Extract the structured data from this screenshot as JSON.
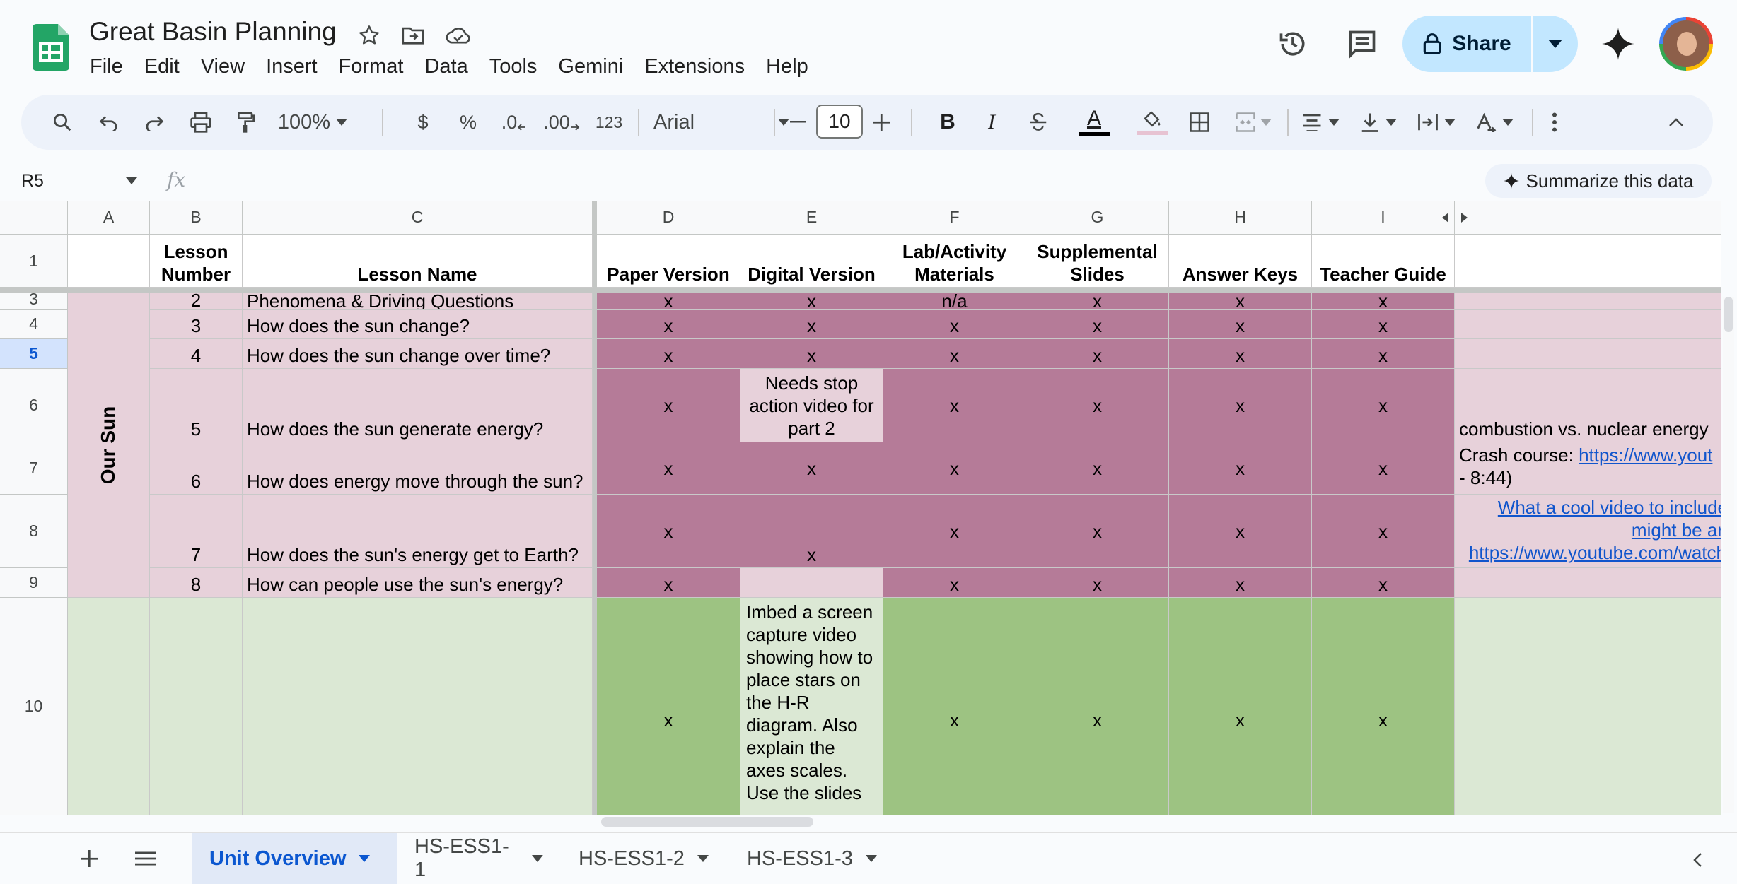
{
  "doc": {
    "title": "Great Basin Planning"
  },
  "menu": [
    "File",
    "Edit",
    "View",
    "Insert",
    "Format",
    "Data",
    "Tools",
    "Gemini",
    "Extensions",
    "Help"
  ],
  "share": {
    "label": "Share"
  },
  "toolbar": {
    "zoom": "100%",
    "currency": "$",
    "percent": "%",
    "dec_decrease": ".0",
    "dec_increase": ".00",
    "number_format": "123",
    "font": "Arial",
    "font_size": "10",
    "bold": "B",
    "italic": "I",
    "text_color_letter": "A"
  },
  "formula_bar": {
    "cell_ref": "R5",
    "fx": "fx",
    "summarize": "Summarize this data"
  },
  "columns": [
    "A",
    "B",
    "C",
    "D",
    "E",
    "F",
    "G",
    "H",
    "I"
  ],
  "header_row": {
    "row": "1",
    "b": "Lesson Number",
    "c": "Lesson Name",
    "d": "Paper Version",
    "e": "Digital Version",
    "f": "Lab/Activity Materials",
    "g": "Supplemental Slides",
    "h": "Answer Keys",
    "i": "Teacher Guide"
  },
  "group_label": "Our Sun",
  "rows": [
    {
      "row": "3",
      "b": "2",
      "c": "Phenomena & Driving Questions",
      "d": "x",
      "e": "x",
      "f": "n/a",
      "g": "x",
      "h": "x",
      "i": "x",
      "j": ""
    },
    {
      "row": "4",
      "b": "3",
      "c": "How does the sun change?",
      "d": "x",
      "e": "x",
      "f": "x",
      "g": "x",
      "h": "x",
      "i": "x",
      "j": ""
    },
    {
      "row": "5",
      "b": "4",
      "c": "How does the sun change over time?",
      "d": "x",
      "e": "x",
      "f": "x",
      "g": "x",
      "h": "x",
      "i": "x",
      "j": ""
    },
    {
      "row": "6",
      "b": "5",
      "c": "How does the sun generate energy?",
      "d": "x",
      "e": "Needs stop action video for part 2",
      "f": "x",
      "g": "x",
      "h": "x",
      "i": "x",
      "j": "combustion vs. nuclear energy"
    },
    {
      "row": "7",
      "b": "6",
      "c": "How does energy move through the sun?",
      "d": "x",
      "e": "x",
      "f": "x",
      "g": "x",
      "h": "x",
      "i": "x",
      "j_prefix": "Crash course: ",
      "j_link": "https://www.yout",
      "j_suffix": "- 8:44)"
    },
    {
      "row": "8",
      "b": "7",
      "c": "How does the sun's energy get to Earth?",
      "d": "x",
      "e": "x",
      "f": "x",
      "g": "x",
      "h": "x",
      "i": "x",
      "j_link1": "What a cool video to include",
      "j_link2": "might be ar",
      "j_link3": "https://www.youtube.com/watch"
    },
    {
      "row": "9",
      "b": "8",
      "c": "How can people use the sun's energy?",
      "d": "x",
      "e": "",
      "f": "x",
      "g": "x",
      "h": "x",
      "i": "x",
      "j": ""
    },
    {
      "row": "10",
      "b": "",
      "c": "",
      "d": "x",
      "e": "Imbed a screen capture video showing how to place stars on the H-R diagram. Also explain the axes scales. Use the slides",
      "f": "x",
      "g": "x",
      "h": "x",
      "i": "x",
      "j": ""
    }
  ],
  "sheet_tabs": [
    "Unit Overview",
    "HS-ESS1-1",
    "HS-ESS1-2",
    "HS-ESS1-3"
  ],
  "colors": {
    "pink": "#e7d1da",
    "dark_pink": "#b57b98",
    "light_green": "#dbe8d4",
    "green": "#9dc382",
    "share_bg": "#c2e7ff"
  }
}
